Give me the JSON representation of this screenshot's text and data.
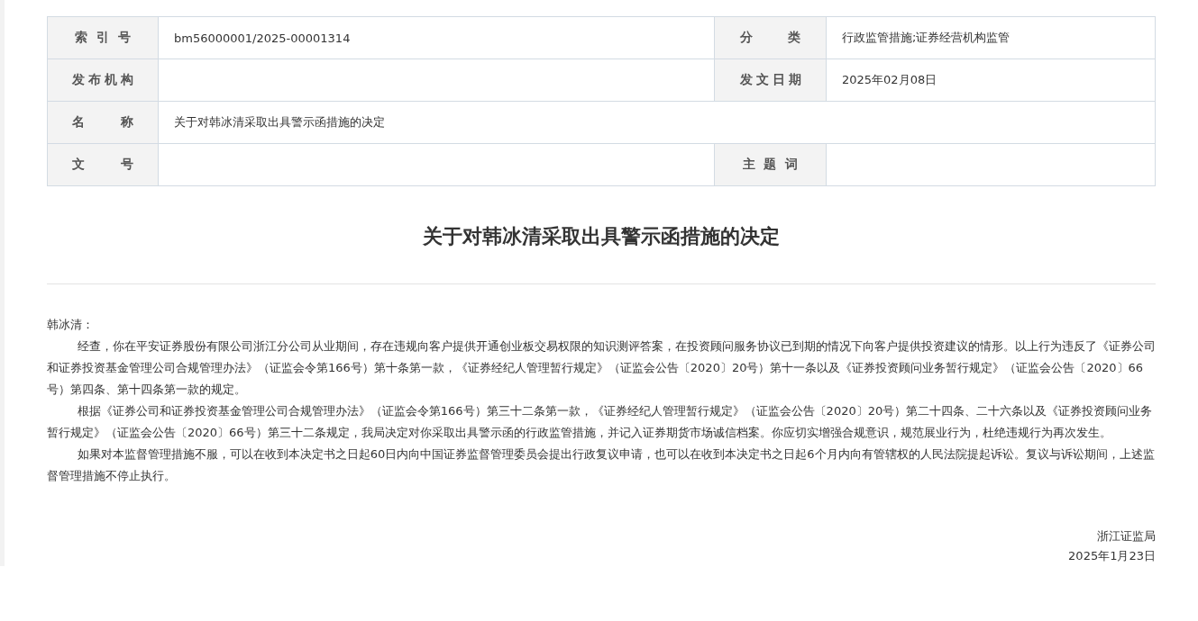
{
  "info_table": {
    "rows": [
      {
        "cells": [
          {
            "kind": "label",
            "text": "索 引 号"
          },
          {
            "kind": "value",
            "text": "bm56000001/2025-00001314"
          },
          {
            "kind": "label",
            "text": "分 类"
          },
          {
            "kind": "value",
            "text": "行政监管措施;证券经营机构监管"
          }
        ]
      },
      {
        "cells": [
          {
            "kind": "label",
            "text": "发布机构"
          },
          {
            "kind": "value"
          },
          {
            "kind": "label",
            "text": "发文日期"
          },
          {
            "kind": "value",
            "text": "2025年02月08日"
          }
        ]
      },
      {
        "cells": [
          {
            "kind": "label",
            "text": "名 称"
          },
          {
            "kind": "value",
            "text": "关于对韩冰清采取出具警示函措施的决定"
          }
        ]
      },
      {
        "cells": [
          {
            "kind": "label",
            "text": "文 号"
          },
          {
            "kind": "value"
          },
          {
            "kind": "label",
            "text": "主 题 词"
          },
          {
            "kind": "value"
          }
        ]
      }
    ]
  },
  "document": {
    "title": "关于对韩冰清采取出具警示函措施的决定",
    "salutation": "韩冰清：",
    "paragraphs": [
      "经查，你在平安证券股份有限公司浙江分公司从业期间，存在违规向客户提供开通创业板交易权限的知识测评答案，在投资顾问服务协议已到期的情况下向客户提供投资建议的情形。以上行为违反了《证券公司和证券投资基金管理公司合规管理办法》（证监会令第166号）第十条第一款，《证券经纪人管理暂行规定》（证监会公告〔2020〕20号）第十一条以及《证券投资顾问业务暂行规定》（证监会公告〔2020〕66号）第四条、第十四条第一款的规定。",
      "根据《证券公司和证券投资基金管理公司合规管理办法》（证监会令第166号）第三十二条第一款，《证券经纪人管理暂行规定》（证监会公告〔2020〕20号）第二十四条、二十六条以及《证券投资顾问业务暂行规定》（证监会公告〔2020〕66号）第三十二条规定，我局决定对你采取出具警示函的行政监管措施，并记入证券期货市场诚信档案。你应切实增强合规意识，规范展业行为，杜绝违规行为再次发生。",
      "如果对本监督管理措施不服，可以在收到本决定书之日起60日内向中国证券监督管理委员会提出行政复议申请，也可以在收到本决定书之日起6个月内向有管辖权的人民法院提起诉讼。复议与诉讼期间，上述监督管理措施不停止执行。"
    ],
    "issuer": "浙江证监局",
    "date": "2025年1月23日"
  }
}
